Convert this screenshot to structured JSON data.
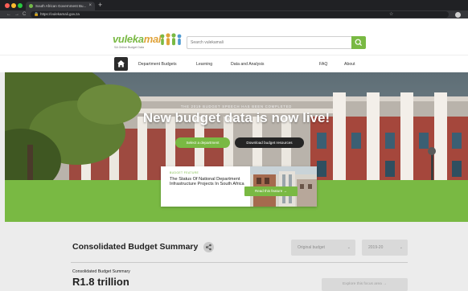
{
  "browser": {
    "tab_title": "South African Government Bu...",
    "tab_close": "×",
    "new_tab": "+",
    "url": "https://vulekamali.gov.za",
    "nav": {
      "back": "←",
      "forward": "→",
      "reload": "C"
    },
    "lock": "🔒",
    "star": "☆"
  },
  "header": {
    "logo_text_1": "vuleka",
    "logo_text_2": "mali",
    "logo_tag": "SA Online Budget Data",
    "search_placeholder": "Search vulekamali"
  },
  "nav": {
    "items": [
      "Department Budgets",
      "Learning",
      "Data and Analysis",
      "FAQ",
      "About"
    ]
  },
  "hero": {
    "label": "THE 2019 BUDGET SPEECH HAS BEEN COMPLETED",
    "title": "New budget data is now live!",
    "button_select": "Select a department",
    "button_download": "Download budget resources"
  },
  "feature": {
    "kicker": "BUDGET FEATURE",
    "title": "The Status Of National Department Infrastructure Projects In South Africa",
    "button": "Read this feature →"
  },
  "summary": {
    "title": "Consolidated Budget Summary",
    "dropdown_budget": "Original budget",
    "dropdown_year": "2019-20",
    "dropdown_arrow": "⌄",
    "sub_label": "Consolidated Budget Summary",
    "value": "R1.8 trillion",
    "explore_button": "Explore this focus area →"
  },
  "colors": {
    "brand_green": "#79b943",
    "dark": "#252525",
    "hero_sky": "#6d7c83"
  }
}
